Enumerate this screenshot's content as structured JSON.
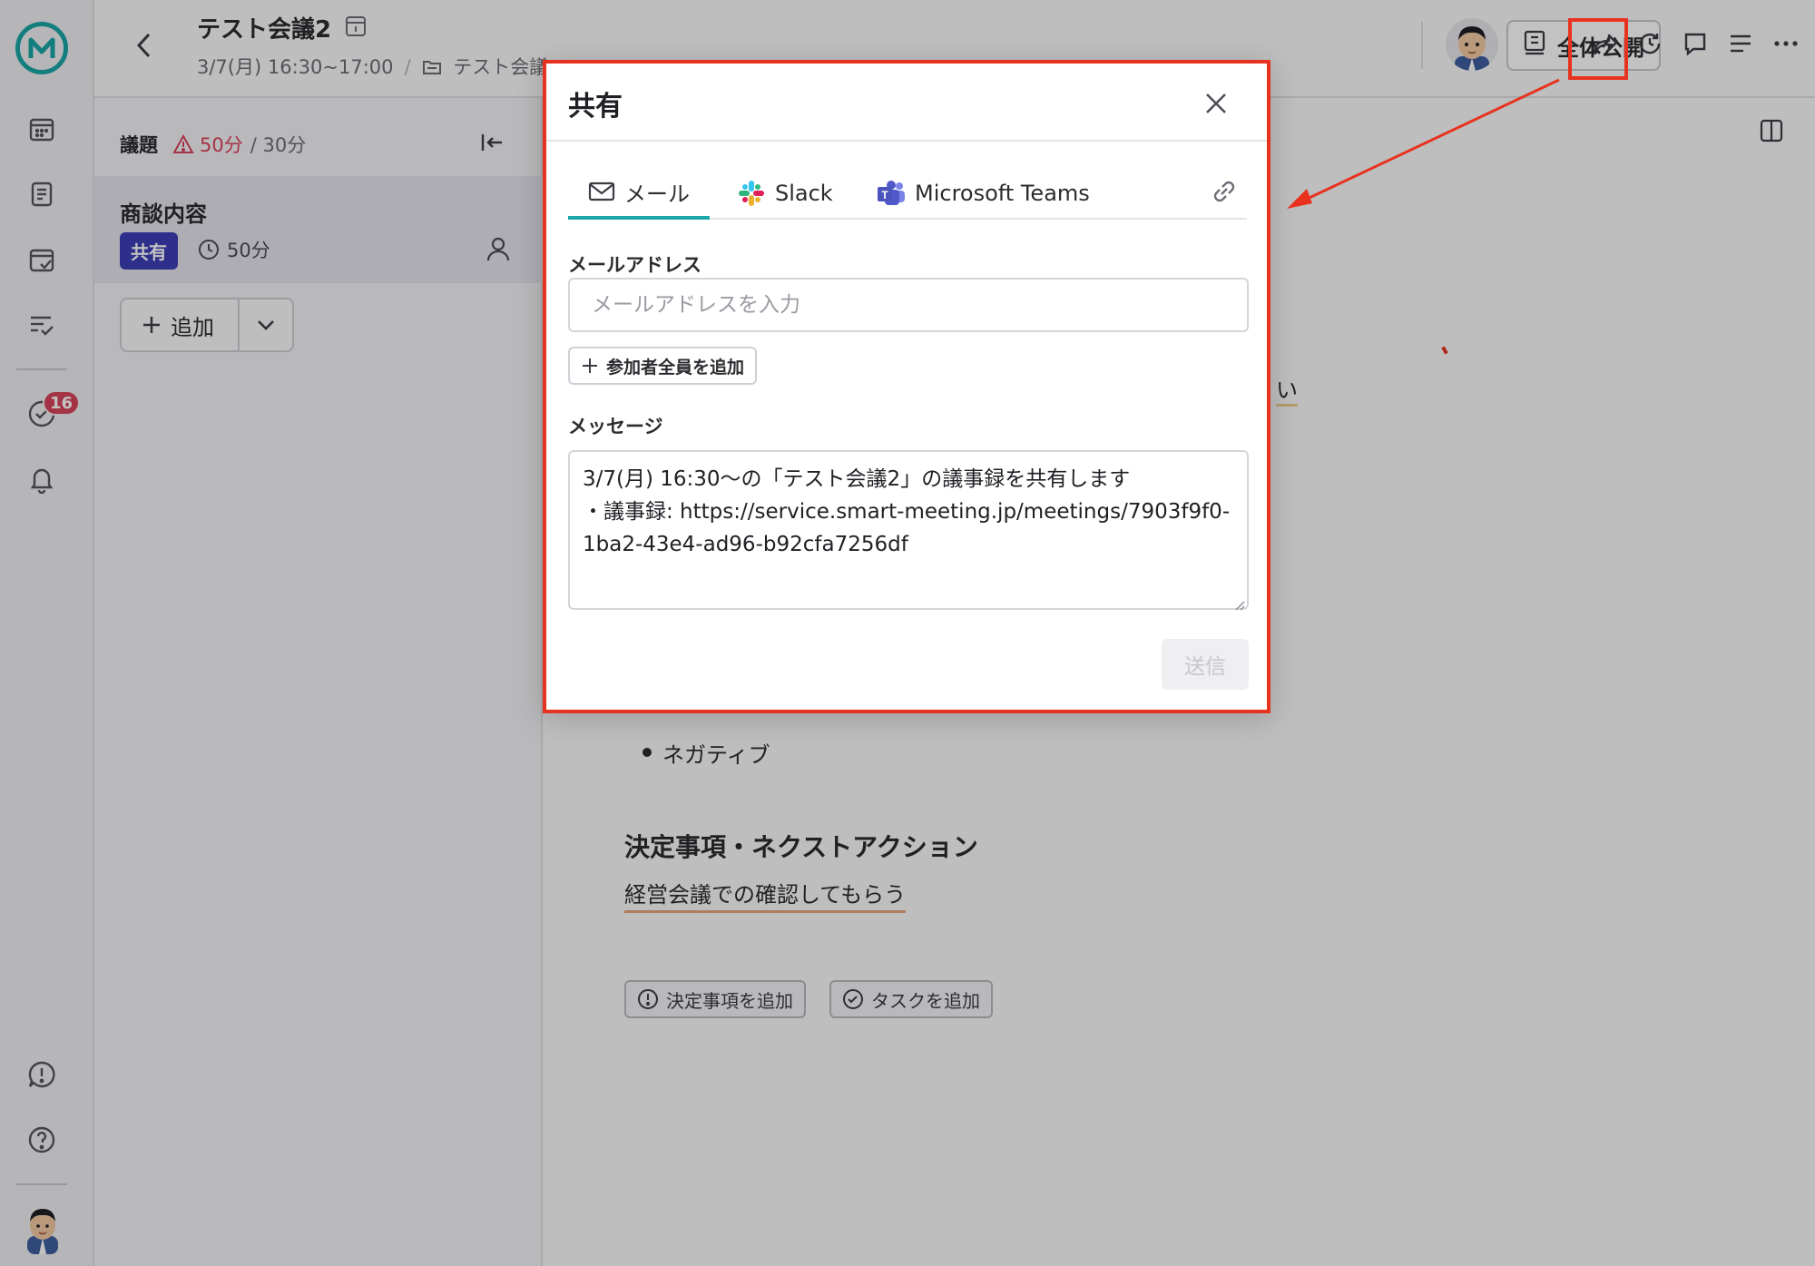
{
  "header": {
    "title": "テスト会議2",
    "datetime": "3/7(月) 16:30~17:00",
    "folder": "テスト会議",
    "visibility_label": "全体公開"
  },
  "rail": {
    "badge_count": "16"
  },
  "agenda": {
    "heading": "議題",
    "overtime": "50分",
    "planned": "/ 30分",
    "item": {
      "name": "商談内容",
      "tag": "共有",
      "duration": "50分"
    },
    "add_label": "追加"
  },
  "document": {
    "partial_hl": "い",
    "bullet_negative": "ネガティブ",
    "decision_heading": "決定事項・ネクストアクション",
    "decision_text": "経営会議での確認してもらう",
    "add_decision_label": "決定事項を追加",
    "add_task_label": "タスクを追加"
  },
  "modal": {
    "title": "共有",
    "tabs": [
      {
        "label": "メール",
        "icon": "mail-icon",
        "active": true
      },
      {
        "label": "Slack",
        "icon": "slack-icon",
        "active": false
      },
      {
        "label": "Microsoft Teams",
        "icon": "teams-icon",
        "active": false
      }
    ],
    "email_label": "メールアドレス",
    "email_placeholder": "メールアドレスを入力",
    "add_all_label": "参加者全員を追加",
    "message_label": "メッセージ",
    "message_value": "3/7(月) 16:30〜の「テスト会議2」の議事録を共有します\n・議事録: https://service.smart-meeting.jp/meetings/7903f9f0-1ba2-43e4-ad96-b92cfa7256df",
    "send_label": "送信"
  },
  "colors": {
    "accent": "#1ba6a8",
    "annotation_red": "#e8321f",
    "tag_bg": "#3d3fb6",
    "warning": "#d8445c"
  }
}
